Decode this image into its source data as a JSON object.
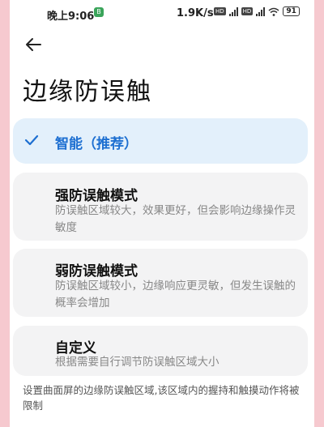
{
  "status_bar": {
    "time": "晚上9:06",
    "sim_badge": "B",
    "net_speed": "1.9K/s",
    "hd1": "HD",
    "hd2": "HD",
    "battery": "91"
  },
  "page": {
    "title": "边缘防误触"
  },
  "options": [
    {
      "title": "智能（推荐）",
      "desc": "",
      "selected": true
    },
    {
      "title": "强防误触模式",
      "desc": "防误触区域较大，效果更好，但会影响边缘操作灵敏度",
      "selected": false
    },
    {
      "title": "弱防误触模式",
      "desc": "防误触区域较小，边缘响应更灵敏，但发生误触的概率会增加",
      "selected": false
    },
    {
      "title": "自定义",
      "desc": "根据需要自行调节防误触区域大小",
      "selected": false
    }
  ],
  "footer": {
    "note": "设置曲面屏的边缘防误触区域,该区域内的握持和触摸动作将被限制"
  },
  "colors": {
    "accent": "#1d6fd1",
    "selected_bg": "#e3f0fb",
    "card_bg": "#f3f3f4",
    "outer_bg": "#f6c9cf"
  }
}
